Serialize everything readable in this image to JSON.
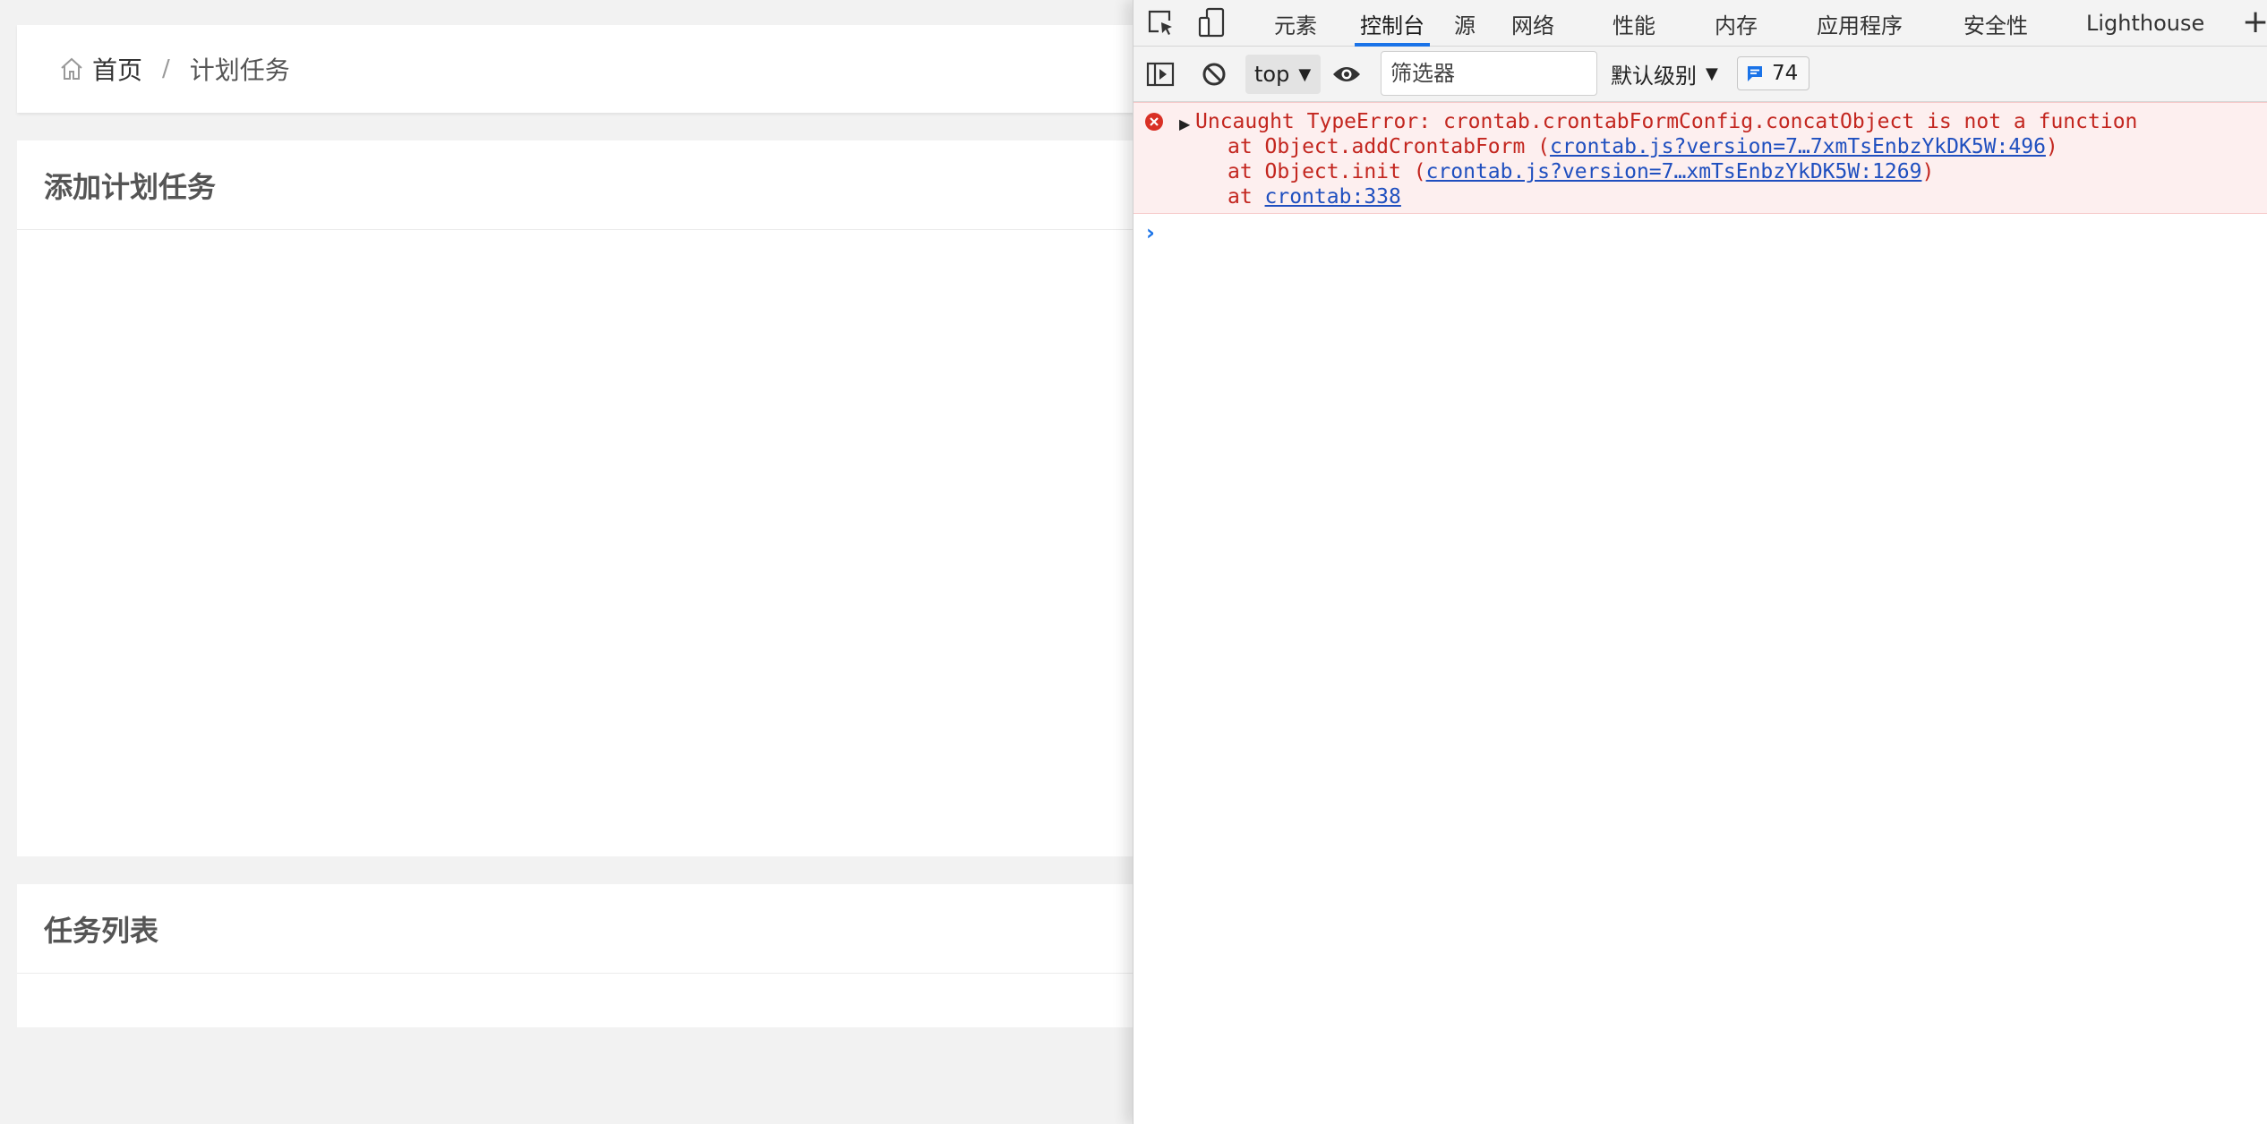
{
  "breadcrumb": {
    "home": "首页",
    "separator": "/",
    "current": "计划任务"
  },
  "cards": {
    "add_title": "添加计划任务",
    "list_title": "任务列表"
  },
  "devtools": {
    "tabs": [
      "元素",
      "控制台",
      "源",
      "网络",
      "性能",
      "内存",
      "应用程序",
      "安全性",
      "Lighthouse"
    ],
    "active_tab": "控制台",
    "plus": "+",
    "toolbar": {
      "context": "top",
      "context_caret": "▼",
      "filter_placeholder": "筛选器",
      "levels": "默认级别",
      "levels_caret": "▼",
      "issues_count": "74"
    },
    "error": {
      "message": "Uncaught TypeError: crontab.crontabFormConfig.concatObject is not a function",
      "frames": [
        {
          "prefix": "at Object.addCrontabForm (",
          "link": "crontab.js?version=7…7xmTsEnbzYkDK5W:496",
          "suffix": ")"
        },
        {
          "prefix": "at Object.init (",
          "link": "crontab.js?version=7…xmTsEnbzYkDK5W:1269",
          "suffix": ")"
        },
        {
          "prefix": "at ",
          "link": "crontab:338",
          "suffix": ""
        }
      ]
    },
    "prompt": "›"
  },
  "colors": {
    "accent": "#1a73e8",
    "error_text": "#c3261f",
    "error_bg": "#fdefef",
    "link": "#1f4fbf"
  }
}
